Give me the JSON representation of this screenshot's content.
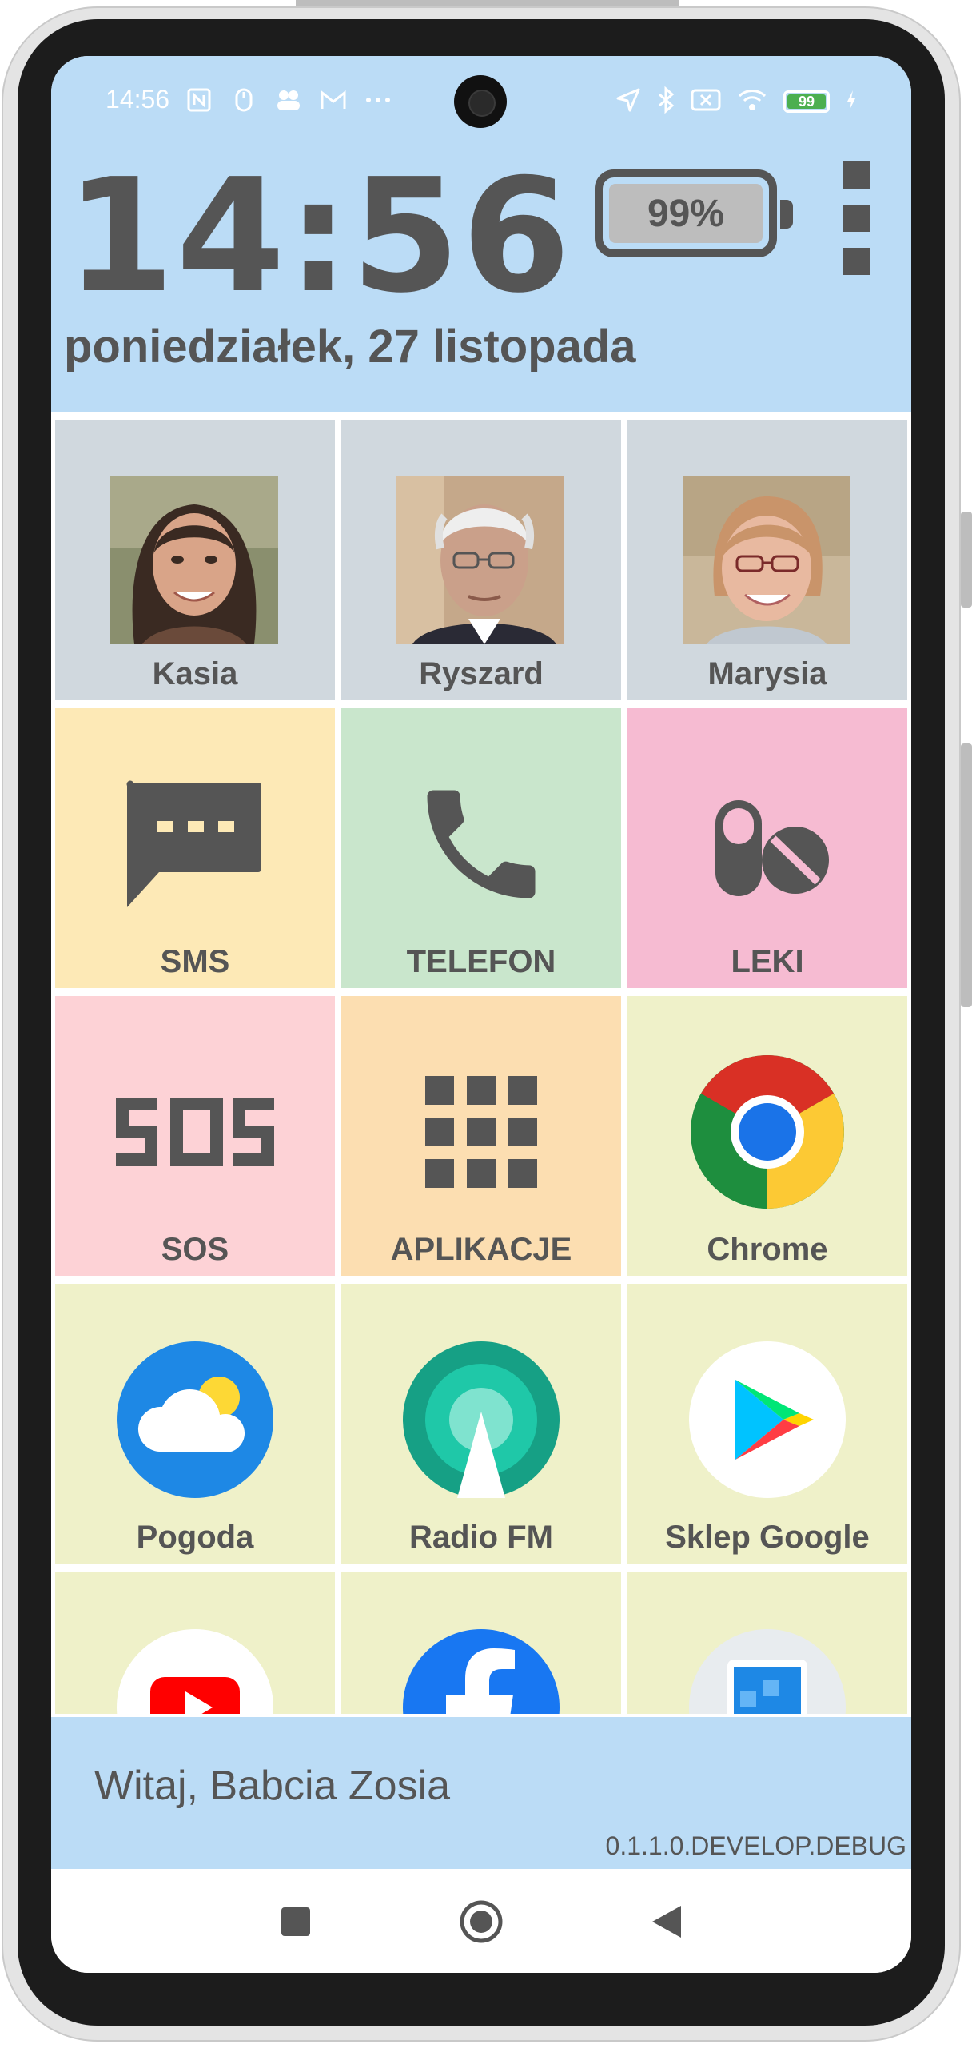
{
  "statusbar": {
    "time": "14:56",
    "battery_level": "99",
    "icons": [
      "nfc-icon",
      "mouse-icon",
      "people-icon",
      "gmail-icon",
      "more-dots-icon",
      "location-icon",
      "bluetooth-icon",
      "sim-off-icon",
      "wifi-icon",
      "battery-icon",
      "charging-icon"
    ]
  },
  "header": {
    "clock": "14:56",
    "date": "poniedziałek, 27 listopada",
    "battery_percent": "99%"
  },
  "tiles": [
    {
      "label": "Kasia",
      "type": "contact",
      "bg": "#d0d8de"
    },
    {
      "label": "Ryszard",
      "type": "contact",
      "bg": "#d0d8de"
    },
    {
      "label": "Marysia",
      "type": "contact",
      "bg": "#d0d8de"
    },
    {
      "label": "SMS",
      "icon": "sms-icon",
      "bg": "#fde9b6"
    },
    {
      "label": "TELEFON",
      "icon": "phone-icon",
      "bg": "#c9e6cc"
    },
    {
      "label": "LEKI",
      "icon": "pills-icon",
      "bg": "#f6bbd2"
    },
    {
      "label": "SOS",
      "icon": "sos-icon",
      "bg": "#fdd2d6"
    },
    {
      "label": "APLIKACJE",
      "icon": "apps-grid-icon",
      "bg": "#fcdeb1"
    },
    {
      "label": "Chrome",
      "icon": "chrome-icon",
      "bg": "#eff1c9"
    },
    {
      "label": "Pogoda",
      "icon": "weather-icon",
      "bg": "#eff1c9"
    },
    {
      "label": "Radio FM",
      "icon": "radio-icon",
      "bg": "#eff1c9"
    },
    {
      "label": "Sklep Google",
      "icon": "play-store-icon",
      "bg": "#eff1c9"
    },
    {
      "label": "",
      "icon": "youtube-icon",
      "bg": "#eff1c9"
    },
    {
      "label": "",
      "icon": "facebook-icon",
      "bg": "#eff1c9"
    },
    {
      "label": "",
      "icon": "app-icon",
      "bg": "#eff1c9"
    }
  ],
  "footer": {
    "greeting": "Witaj, Babcia Zosia",
    "version": "0.1.1.0.DEVELOP.DEBUG"
  },
  "colors": {
    "header_bg": "#bbdcf6",
    "text_gray": "#555555"
  }
}
